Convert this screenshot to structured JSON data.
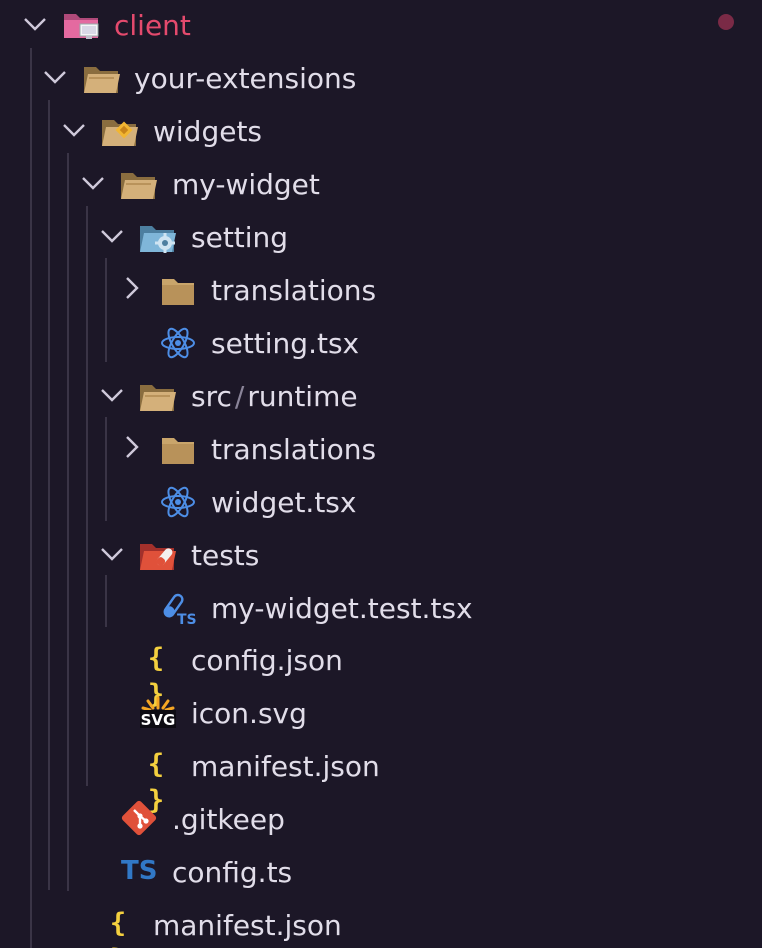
{
  "colors": {
    "background": "#1c1727",
    "text": "#e1dde9",
    "client_accent": "#e44a6d",
    "modified_dot": "#7a2a46",
    "folder": "#c9a56b",
    "react": "#4d8ee6",
    "json_brace": "#f4d03f",
    "typescript": "#3178c6",
    "git": "#e0513a"
  },
  "tree": {
    "root": {
      "label": "client",
      "icon": "folder-client-icon",
      "expanded": true,
      "status": "modified-dot"
    },
    "your_extensions": {
      "label": "your-extensions",
      "icon": "folder-icon",
      "expanded": true
    },
    "widgets": {
      "label": "widgets",
      "icon": "folder-widgets-icon",
      "expanded": true
    },
    "my_widget": {
      "label": "my-widget",
      "icon": "folder-icon",
      "expanded": true
    },
    "setting": {
      "label": "setting",
      "icon": "folder-setting-icon",
      "expanded": true
    },
    "setting_translations": {
      "label": "translations",
      "icon": "folder-closed-icon",
      "expanded": false
    },
    "setting_tsx": {
      "label": "setting.tsx",
      "icon": "react-icon"
    },
    "src_runtime": {
      "part1": "src",
      "separator": "/",
      "part2": "runtime",
      "icon": "folder-icon",
      "expanded": true
    },
    "runtime_translations": {
      "label": "translations",
      "icon": "folder-closed-icon",
      "expanded": false
    },
    "widget_tsx": {
      "label": "widget.tsx",
      "icon": "react-icon"
    },
    "tests": {
      "label": "tests",
      "icon": "folder-tests-icon",
      "expanded": true
    },
    "test_file": {
      "label": "my-widget.test.tsx",
      "icon": "test-ts-icon"
    },
    "config_json": {
      "label": "config.json",
      "icon": "json-icon",
      "icon_text": "{ }"
    },
    "icon_svg": {
      "label": "icon.svg",
      "icon": "svg-icon",
      "icon_text": "SVG"
    },
    "manifest_json_inner": {
      "label": "manifest.json",
      "icon": "json-icon",
      "icon_text": "{ }"
    },
    "gitkeep": {
      "label": ".gitkeep",
      "icon": "git-icon"
    },
    "config_ts": {
      "label": "config.ts",
      "icon": "typescript-icon",
      "icon_text": "TS"
    },
    "manifest_json_outer": {
      "label": "manifest.json",
      "icon": "json-icon",
      "icon_text": "{ }"
    }
  }
}
